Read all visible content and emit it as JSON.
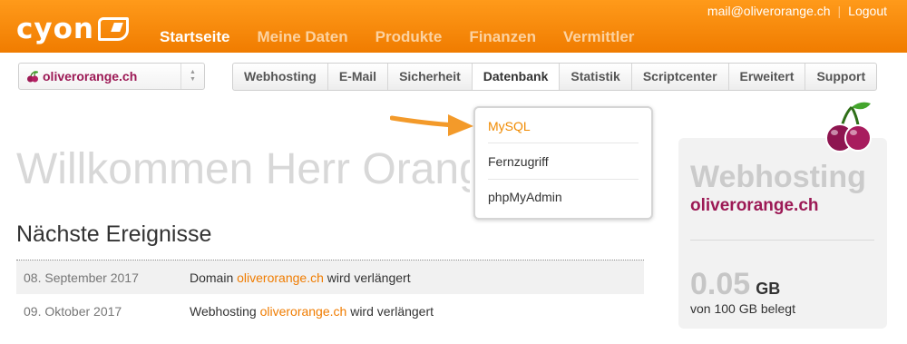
{
  "header": {
    "logo_text": "cyon",
    "nav": [
      {
        "label": "Startseite",
        "active": true
      },
      {
        "label": "Meine Daten"
      },
      {
        "label": "Produkte"
      },
      {
        "label": "Finanzen"
      },
      {
        "label": "Vermittler"
      }
    ],
    "user_email": "mail@oliverorange.ch",
    "logout_label": "Logout"
  },
  "domain_selector": {
    "value": "oliverorange.ch"
  },
  "subnav": {
    "tabs": [
      "Webhosting",
      "E-Mail",
      "Sicherheit",
      "Datenbank",
      "Statistik",
      "Scriptcenter",
      "Erweitert",
      "Support"
    ],
    "active_tab": "Datenbank"
  },
  "dropdown": {
    "items": [
      "MySQL",
      "Fernzugriff",
      "phpMyAdmin"
    ]
  },
  "welcome": "Willkommen Herr Orange",
  "events": {
    "title": "Nächste Ereignisse",
    "rows": [
      {
        "date": "08. September 2017",
        "prefix": "Domain ",
        "domain": "oliverorange.ch",
        "suffix": " wird verlängert"
      },
      {
        "date": "09. Oktober 2017",
        "prefix": "Webhosting ",
        "domain": "oliverorange.ch",
        "suffix": " wird verlängert"
      }
    ]
  },
  "card": {
    "title": "Webhosting",
    "domain": "oliverorange.ch",
    "usage": "0.05",
    "unit": "GB",
    "quota": "von 100 GB belegt"
  },
  "colors": {
    "accent": "#f07c00",
    "brand_domain": "#9c1955"
  },
  "icons": [
    "cherry-icon",
    "up-down-arrows-icon",
    "pointer-arrow-icon"
  ]
}
